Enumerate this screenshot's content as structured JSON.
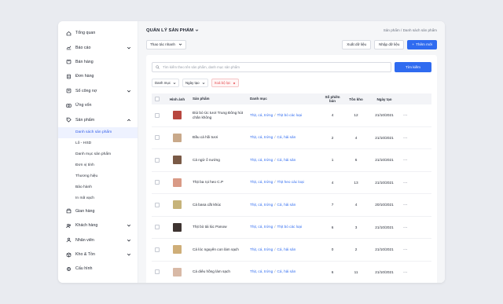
{
  "sidebar": {
    "items": [
      {
        "key": "dashboard",
        "label": "Tổng quan",
        "icon": "home-icon",
        "chevron": false
      },
      {
        "key": "reports",
        "label": "Báo cáo",
        "icon": "chart-icon",
        "chevron": true
      },
      {
        "key": "sales",
        "label": "Bán hàng",
        "icon": "cart-icon",
        "chevron": false
      },
      {
        "key": "orders",
        "label": "Đơn hàng",
        "icon": "receipt-icon",
        "chevron": false
      },
      {
        "key": "ledger",
        "label": "Sổ công nợ",
        "icon": "book-icon",
        "chevron": true
      },
      {
        "key": "advance",
        "label": "Ứng vốn",
        "icon": "money-icon",
        "chevron": false
      },
      {
        "key": "products",
        "label": "Sản phẩm",
        "icon": "tag-icon",
        "chevron": true,
        "expanded": true
      }
    ],
    "sub_items": [
      {
        "label": "Danh sách sản phẩm",
        "active": true
      },
      {
        "label": "Lô - HSD"
      },
      {
        "label": "Danh mục sản phẩm"
      },
      {
        "label": "Đơn vị tính"
      },
      {
        "label": "Thương hiệu"
      },
      {
        "label": "Bảo hành"
      },
      {
        "label": "In mã vạch"
      }
    ],
    "items_after": [
      {
        "key": "stall",
        "label": "Gian hàng",
        "icon": "store-icon",
        "chevron": false
      },
      {
        "key": "customers",
        "label": "Khách hàng",
        "icon": "users-icon",
        "chevron": true
      },
      {
        "key": "staff",
        "label": "Nhân viên",
        "icon": "user-icon",
        "chevron": true
      },
      {
        "key": "warehouse",
        "label": "Kho & Tồn",
        "icon": "box-icon",
        "chevron": true
      },
      {
        "key": "config",
        "label": "Cấu hình",
        "icon": "gear-icon",
        "chevron": false
      }
    ]
  },
  "header": {
    "title": "QUẢN LÝ SẢN PHẨM",
    "breadcrumb_root": "Sản phẩm",
    "breadcrumb_sep": "/",
    "breadcrumb_current": "Danh sách sản phẩm"
  },
  "toolbar": {
    "quick_action": "Thao tác nhanh",
    "export_label": "Xuất dữ liệu",
    "import_label": "Nhập dữ liệu",
    "add_label": "Thêm mới",
    "add_prefix": "+"
  },
  "search": {
    "placeholder": "Tìm kiếm theo tên sản phẩm, danh mục sản phẩm",
    "button_label": "Tìm kiếm"
  },
  "filters": {
    "category": "Danh mục",
    "created_date": "Ngày tạo",
    "clear": "Xoá bộ lọc"
  },
  "table": {
    "columns": {
      "image": "Hình ảnh",
      "product": "Sản phẩm",
      "category": "Danh mục",
      "lots_line1": "Số phiên",
      "lots_line2": "bản",
      "stock": "Tồn kho",
      "created": "Ngày tạo"
    },
    "rows": [
      {
        "name": "Đùi bò Úc tươi Trung Đông hút chân không",
        "cat1": "Thịt, cá, trứng",
        "cat2": "Thịt bò các loại",
        "lots": "4",
        "stock": "12",
        "date": "21/10/2021",
        "thumb": "#b8473f"
      },
      {
        "name": "Đầu cá hồi tươi",
        "cat1": "Thịt, cá, trứng",
        "cat2": "Cá, hải sản",
        "lots": "2",
        "stock": "4",
        "date": "21/10/2021",
        "thumb": "#c9a98a"
      },
      {
        "name": "Cá ngừ ổ nướng",
        "cat1": "Thịt, cá, trứng",
        "cat2": "Cá, hải sản",
        "lots": "1",
        "stock": "6",
        "date": "21/10/2021",
        "thumb": "#7a5a46"
      },
      {
        "name": "Thịt ba rọi heo C.P",
        "cat1": "Thịt, cá, trứng",
        "cat2": "Thịt heo các loại",
        "lots": "4",
        "stock": "13",
        "date": "21/10/2021",
        "thumb": "#d99a86"
      },
      {
        "name": "Cá basa cắt khúc",
        "cat1": "Thịt, cá, trứng",
        "cat2": "Cá, hải sản",
        "lots": "7",
        "stock": "4",
        "date": "20/10/2021",
        "thumb": "#c6b37a"
      },
      {
        "name": "Thịt bò tái lúc Panow",
        "cat1": "Thịt, cá, trứng",
        "cat2": "Thịt bò các loại",
        "lots": "6",
        "stock": "3",
        "date": "21/10/2021",
        "thumb": "#3e3431"
      },
      {
        "name": "Cá lóc nguyên con làm sạch",
        "cat1": "Thịt, cá, trứng",
        "cat2": "Cá, hải sản",
        "lots": "0",
        "stock": "2",
        "date": "21/10/2021",
        "thumb": "#cfae78"
      },
      {
        "name": "Cá diêu hồng làm sạch",
        "cat1": "Thịt, cá, trứng",
        "cat2": "Cá, hải sản",
        "lots": "6",
        "stock": "11",
        "date": "21/10/2021",
        "thumb": "#d8b9a6"
      }
    ],
    "more_glyph": "···"
  },
  "colors": {
    "primary": "#2f6bf0",
    "active_bg": "#eef2ff",
    "danger": "#e5484d"
  }
}
